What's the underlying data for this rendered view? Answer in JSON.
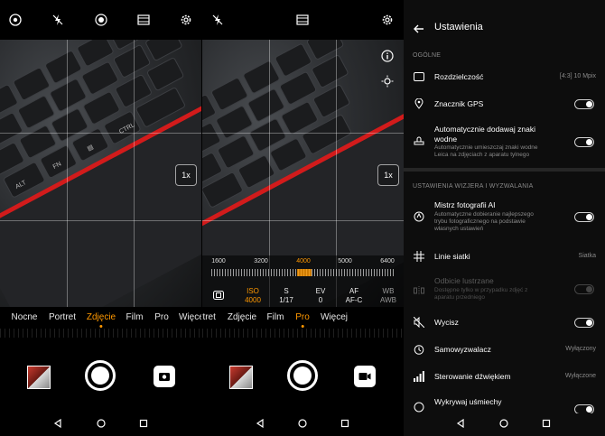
{
  "camera_left": {
    "zoom": "1x",
    "modes": [
      "Nocne",
      "Portret",
      "Zdjęcie",
      "Film",
      "Pro",
      "Więcej"
    ],
    "active_mode": "Zdjęcie",
    "top_icons": [
      "aperture-icon",
      "flash-off-icon",
      "ai-mode-icon",
      "filter-icon",
      "gear-icon"
    ]
  },
  "camera_pro": {
    "zoom": "1x",
    "iso_scale": [
      "1600",
      "3200",
      "4000",
      "5000",
      "6400"
    ],
    "selected_iso": "4000",
    "params": [
      {
        "name": "ISO",
        "value": "4000"
      },
      {
        "name": "S",
        "value": "1/17"
      },
      {
        "name": "EV",
        "value": "0"
      },
      {
        "name": "AF",
        "value": "AF-C"
      },
      {
        "name": "WB",
        "value": "AWB"
      }
    ],
    "modes": [
      "Film",
      "Pro",
      "Więcej"
    ],
    "partial_modes": [
      "rtret",
      "Zdjęcie"
    ],
    "active_mode": "Pro"
  },
  "settings": {
    "title": "Ustawienia",
    "section_general": "OGÓLNE",
    "section_viewfinder": "USTAWIENIA WIZJERA I WYZWALANIA",
    "resolution_label": "Rozdzielczość",
    "resolution_value": "[4:3] 10 Mpix",
    "gps_label": "Znacznik GPS",
    "watermark_label_1": "Automatycznie dodawaj znaki",
    "watermark_label_2": "wodne",
    "watermark_sub_1": "Automatycznie umieszczaj znaki wodne",
    "watermark_sub_2": "Leica na zdjęciach z aparatu tylnego",
    "ai_label": "Mistrz fotografii AI",
    "ai_sub_1": "Automatyczne dobieranie najlepszego",
    "ai_sub_2": "trybu fotograficznego na podstawie",
    "ai_sub_3": "własnych ustawień",
    "grid_label": "Linie siatki",
    "grid_value": "Siatka",
    "mirror_label": "Odbicie lustrzane",
    "mirror_sub_1": "Dostępne tylko w przypadku zdjęć z",
    "mirror_sub_2": "aparatu przedniego",
    "mute_label": "Wycisz",
    "timer_label": "Samowyzwalacz",
    "timer_value": "Wyłączony",
    "audio_label": "Sterowanie dźwiękiem",
    "audio_value": "Wyłączone",
    "smile_label": "Wykrywaj uśmiechy"
  },
  "colors": {
    "accent": "#ff9800",
    "laser": "#d21b1b"
  }
}
